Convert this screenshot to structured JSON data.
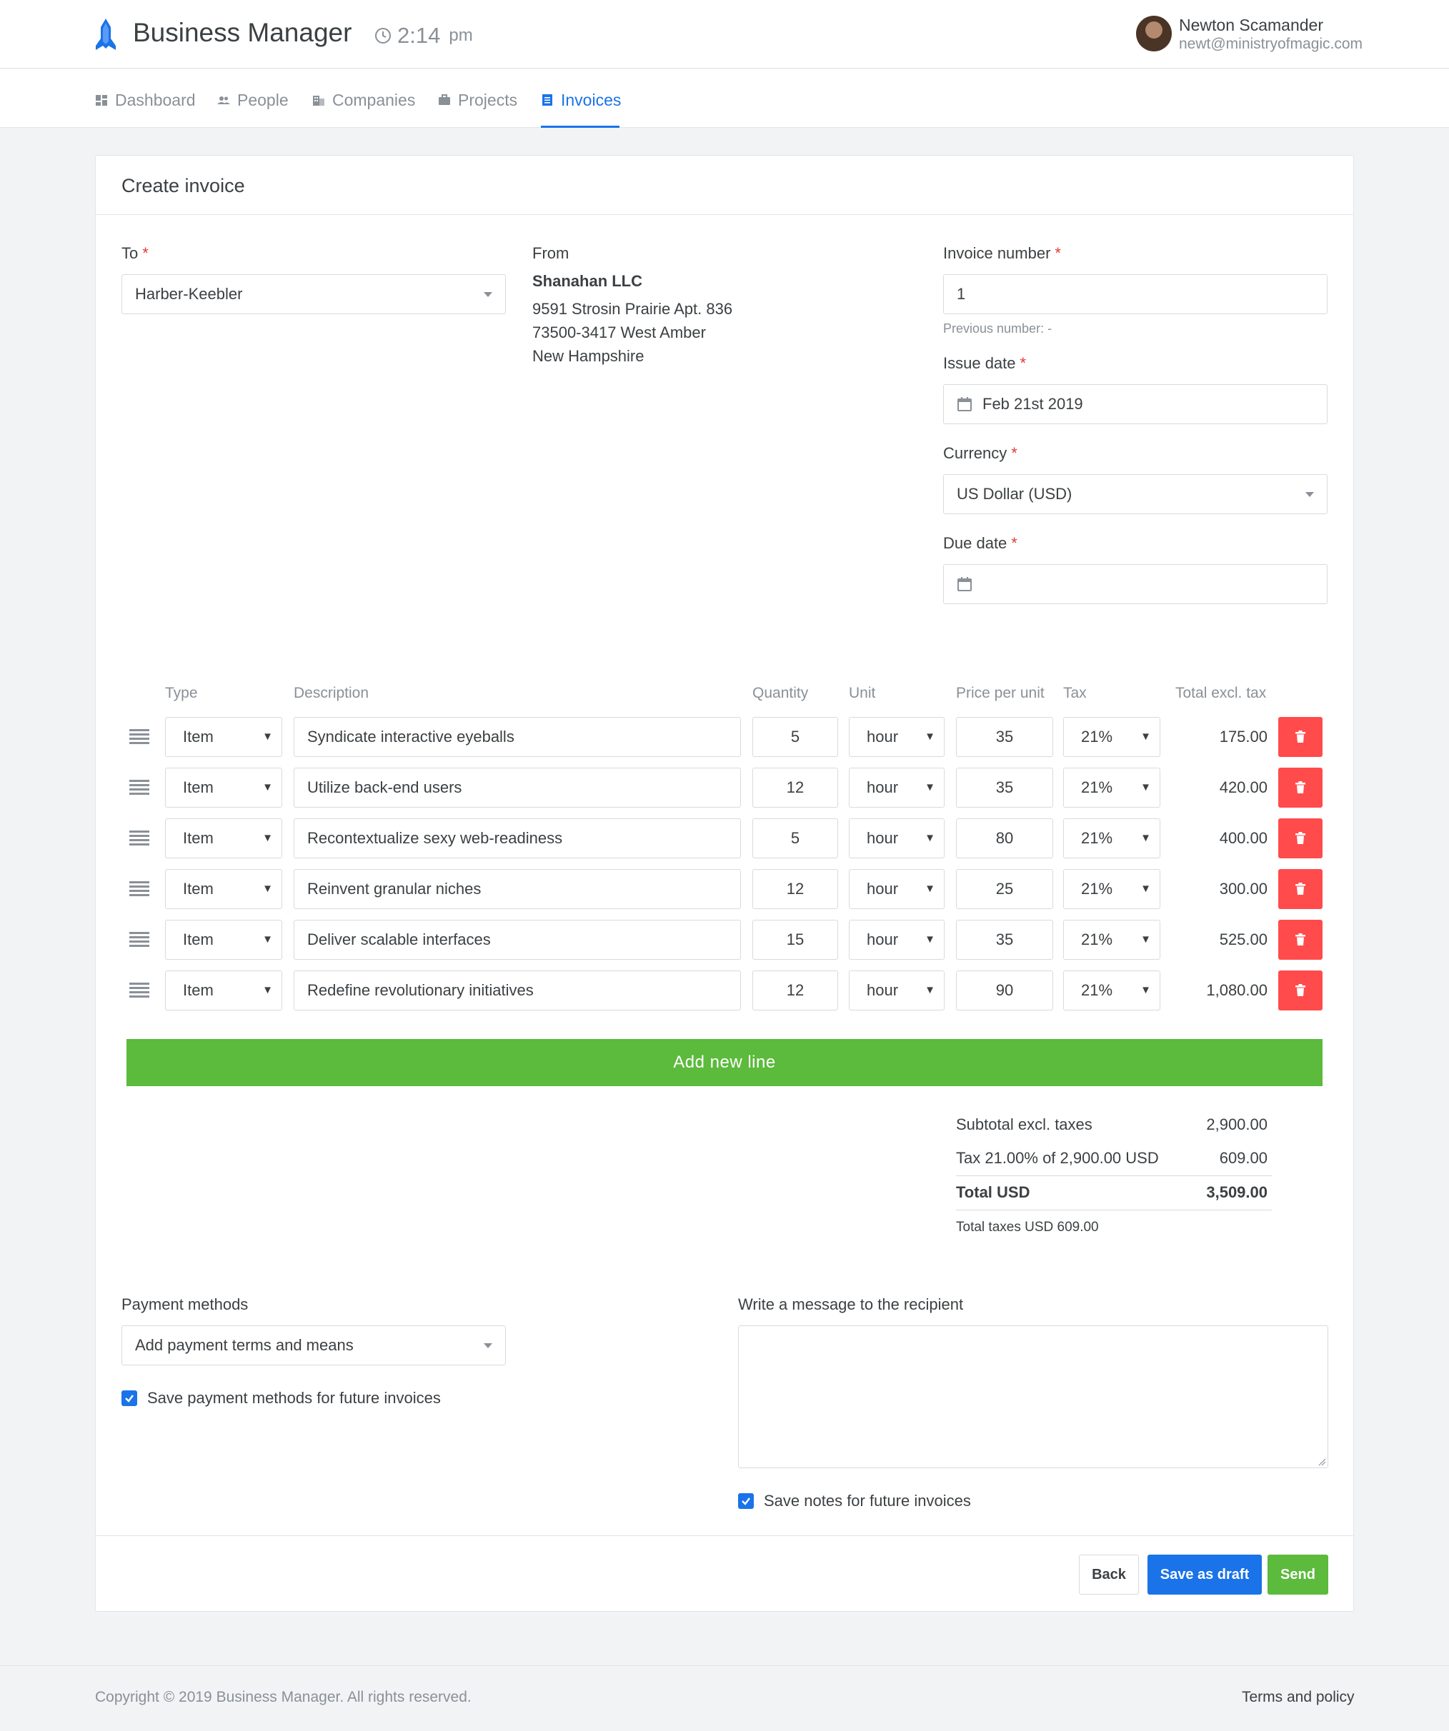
{
  "app": {
    "title": "Business Manager",
    "time": "2:14",
    "ampm": "pm"
  },
  "user": {
    "name": "Newton Scamander",
    "email": "newt@ministryofmagic.com"
  },
  "nav": [
    {
      "label": "Dashboard",
      "icon": "dashboard-icon"
    },
    {
      "label": "People",
      "icon": "people-icon"
    },
    {
      "label": "Companies",
      "icon": "companies-icon"
    },
    {
      "label": "Projects",
      "icon": "projects-icon"
    },
    {
      "label": "Invoices",
      "icon": "invoices-icon",
      "active": true
    }
  ],
  "form": {
    "title": "Create invoice",
    "to_label": "To",
    "to_value": "Harber-Keebler",
    "from_label": "From",
    "from_company": "Shanahan LLC",
    "from_address": [
      "9591 Strosin Prairie Apt. 836",
      "73500-3417 West Amber",
      "New Hampshire"
    ],
    "invoice_number_label": "Invoice number",
    "invoice_number": "1",
    "previous_number": "Previous number: -",
    "issue_date_label": "Issue date",
    "issue_date": "Feb 21st 2019",
    "currency_label": "Currency",
    "currency": "US Dollar (USD)",
    "due_date_label": "Due date",
    "due_date": "",
    "required_mark": "*"
  },
  "table": {
    "headers": [
      "Type",
      "Description",
      "Quantity",
      "Unit",
      "Price per unit",
      "Tax",
      "Total excl. tax"
    ],
    "rows": [
      {
        "type": "Item",
        "description": "Syndicate interactive eyeballs",
        "quantity": "5",
        "unit": "hour",
        "price": "35",
        "tax": "21%",
        "total": "175.00"
      },
      {
        "type": "Item",
        "description": "Utilize back-end users",
        "quantity": "12",
        "unit": "hour",
        "price": "35",
        "tax": "21%",
        "total": "420.00"
      },
      {
        "type": "Item",
        "description": "Recontextualize sexy web-readiness",
        "quantity": "5",
        "unit": "hour",
        "price": "80",
        "tax": "21%",
        "total": "400.00"
      },
      {
        "type": "Item",
        "description": "Reinvent granular niches",
        "quantity": "12",
        "unit": "hour",
        "price": "25",
        "tax": "21%",
        "total": "300.00"
      },
      {
        "type": "Item",
        "description": "Deliver scalable interfaces",
        "quantity": "15",
        "unit": "hour",
        "price": "35",
        "tax": "21%",
        "total": "525.00"
      },
      {
        "type": "Item",
        "description": "Redefine revolutionary initiatives",
        "quantity": "12",
        "unit": "hour",
        "price": "90",
        "tax": "21%",
        "total": "1,080.00"
      }
    ],
    "add_line": "Add new line"
  },
  "summary": {
    "subtotal_label": "Subtotal excl. taxes",
    "subtotal": "2,900.00",
    "tax_label": "Tax 21.00% of 2,900.00 USD",
    "tax": "609.00",
    "total_label": "Total USD",
    "total": "3,509.00",
    "taxes_note": "Total taxes USD 609.00"
  },
  "payment": {
    "label": "Payment methods",
    "placeholder": "Add payment terms and means",
    "save_label": "Save payment methods for future invoices",
    "save_checked": true
  },
  "message": {
    "label": "Write a message to the recipient",
    "value": "",
    "save_label": "Save notes for future invoices",
    "save_checked": true
  },
  "actions": {
    "back": "Back",
    "draft": "Save as draft",
    "send": "Send"
  },
  "footer": {
    "copyright": "Copyright © 2019 Business Manager. All rights reserved.",
    "terms": "Terms and policy"
  },
  "colors": {
    "accent": "#1a73e8",
    "success": "#5cba3c",
    "danger": "#ff4b4b",
    "required": "#e53935"
  }
}
